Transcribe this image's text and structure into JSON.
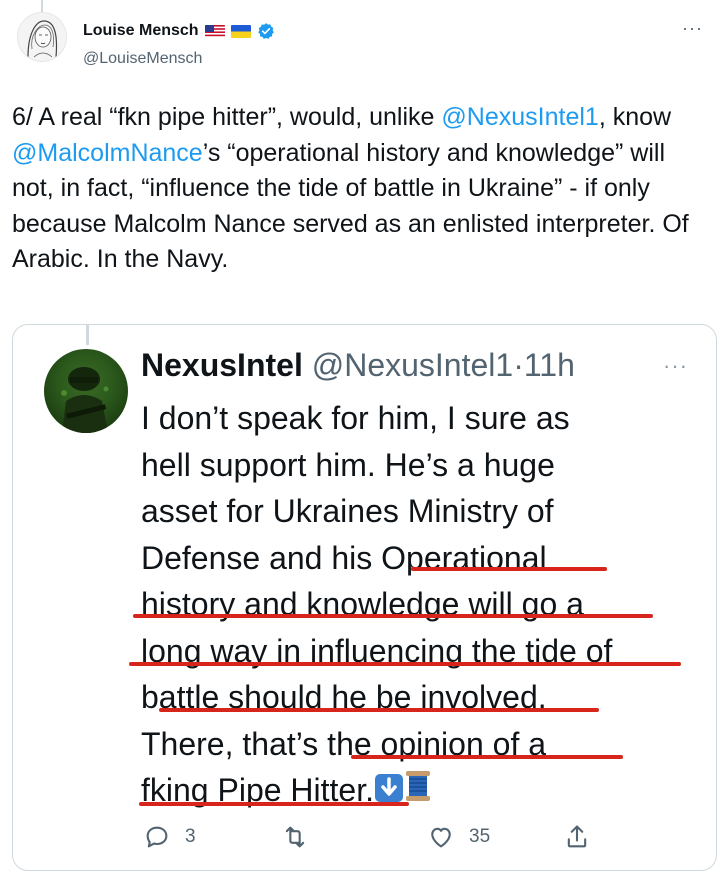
{
  "author": {
    "display_name": "Louise Mensch",
    "handle": "@LouiseMensch"
  },
  "tweet": {
    "p1": "6/ A real “fkn pipe hitter”, would, unlike ",
    "mention1": "@NexusIntel1",
    "p2": ", know ",
    "mention2": "@MalcolmNance",
    "p3": "’s “operational history and knowledge” will not, in fact, “influence the tide of battle in Ukraine” - if only because Malcolm Nance served as an enlisted interpreter. Of Arabic. In the Navy."
  },
  "quoted": {
    "name": "NexusIntel",
    "handle": "@NexusIntel1",
    "separator": "·",
    "time": "11h",
    "text": "I don’t speak for him, I sure as\nhell support him. He’s a huge\nasset for Ukraines Ministry of\nDefense and his Operational\nhistory and knowledge will go a\nlong way in influencing the tide of\nbattle should he be involved.\nThere, that’s the opinion of a\nfking Pipe Hitter.",
    "reply_count": "3",
    "like_count": "35"
  },
  "colors": {
    "link": "#1d9bf0",
    "underline": "#d7251b",
    "muted": "#536471"
  },
  "icons": [
    "flag-us-icon",
    "flag-ukraine-icon",
    "verified-badge-icon",
    "more-icon",
    "arrow-down-emoji-icon",
    "thread-spool-emoji-icon",
    "reply-icon",
    "retweet-icon",
    "like-icon",
    "share-icon"
  ]
}
